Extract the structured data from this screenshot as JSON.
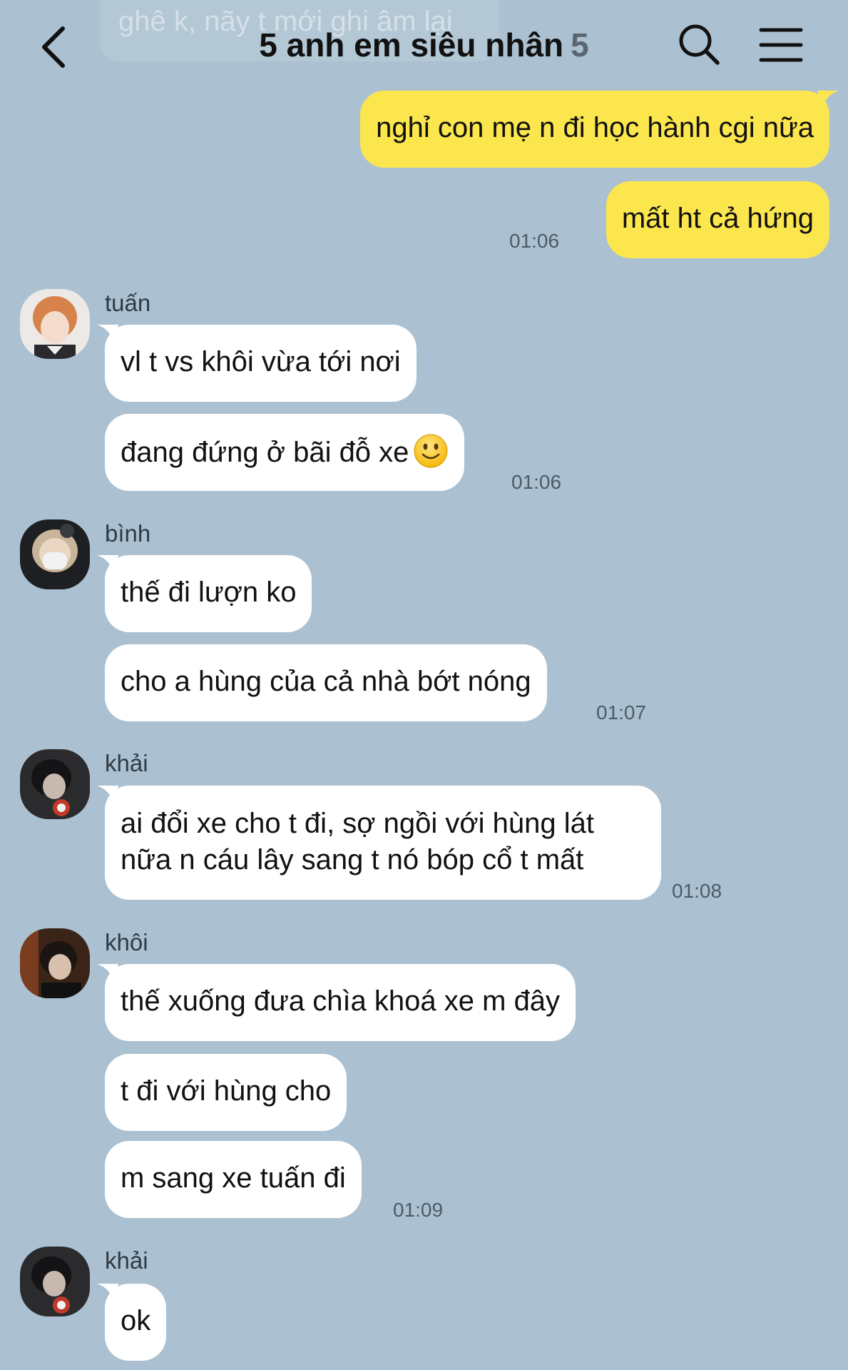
{
  "header": {
    "title": "5 anh em siêu nhân",
    "member_count": "5",
    "back_icon": "chevron-left-icon",
    "search_icon": "search-icon",
    "menu_icon": "hamburger-menu-icon"
  },
  "previous_message": {
    "text": "ghê k, nãy t mới ghi âm lại"
  },
  "outgoing": {
    "messages": [
      "nghỉ con mẹ n đi học hành cgi nữa",
      "mất ht cả hứng"
    ],
    "time": "01:06",
    "color": "#fbe64d"
  },
  "groups": [
    {
      "sender": "tuấn",
      "messages": [
        "vl t vs khôi vừa tới nơi",
        "đang đứng ở bãi đỗ xe"
      ],
      "emoji": "slightly-smiling-face-icon",
      "time": "01:06"
    },
    {
      "sender": "bình",
      "messages": [
        "thế đi lượn ko",
        "cho a hùng của cả nhà bớt nóng"
      ],
      "time": "01:07"
    },
    {
      "sender": "khải",
      "messages": [
        "ai đổi xe cho t đi, sợ ngồi với hùng lát nữa n cáu lây sang t nó bóp cổ t mất"
      ],
      "time": "01:08"
    },
    {
      "sender": "khôi",
      "messages": [
        "thế xuống đưa chìa khoá xe m đây",
        "t đi với hùng cho",
        "m sang xe tuấn đi"
      ],
      "time": "01:09"
    },
    {
      "sender": "khải",
      "messages": [
        "ok"
      ]
    }
  ],
  "colors": {
    "background": "#abc1d1",
    "incoming_bubble": "#ffffff",
    "outgoing_bubble": "#fbe64d"
  }
}
